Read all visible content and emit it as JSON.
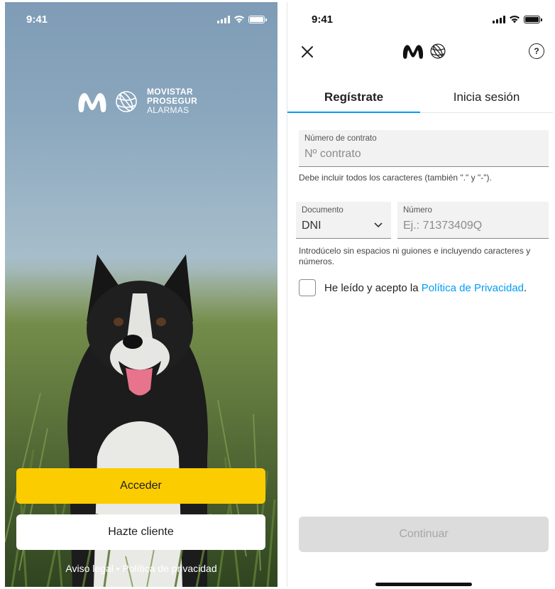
{
  "left_screen": {
    "status_time": "9:41",
    "brand": {
      "line1": "MOVISTAR",
      "line2": "PROSEGUR",
      "line3": "ALARMAS"
    },
    "primary_button": "Acceder",
    "secondary_button": "Hazte cliente",
    "legal_link": "Aviso legal",
    "separator": "•",
    "privacy_link": "Política de privacidad",
    "colors": {
      "primary": "#fbcd00"
    }
  },
  "right_screen": {
    "status_time": "9:41",
    "tabs": [
      {
        "label": "Regístrate",
        "active": true
      },
      {
        "label": "Inicia sesión",
        "active": false
      }
    ],
    "contract": {
      "label": "Número de contrato",
      "placeholder": "Nº contrato",
      "hint": "Debe incluir todos los caracteres (también \".\" y \"-\")."
    },
    "document": {
      "type_label": "Documento",
      "type_value": "DNI",
      "number_label": "Número",
      "number_placeholder": "Ej.: 71373409Q",
      "hint": "Introdúcelo sin espacios ni guiones e incluyendo caracteres y números."
    },
    "privacy": {
      "text": "He leído y acepto la ",
      "link": "Política de Privacidad",
      "end": "."
    },
    "continue_button": "Continuar",
    "colors": {
      "accent": "#019df4"
    }
  }
}
